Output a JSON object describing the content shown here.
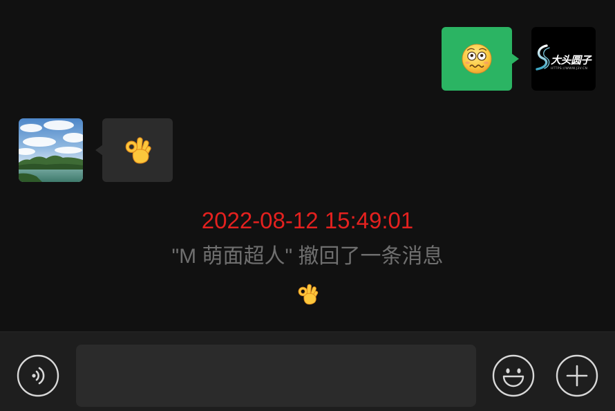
{
  "outgoing_message": {
    "bubble_color": "#2bb463",
    "sticker_icon": "nervous-face-icon",
    "avatar": {
      "icon": "brand-logo-avatar",
      "logo_text": "大头圆子",
      "logo_subtext": "HTTPS://WWW.J3V.CN"
    }
  },
  "incoming_message": {
    "bubble_color": "#2c2c2c",
    "sticker_icon": "ok-hand-icon",
    "avatar": {
      "icon": "landscape-photo-avatar"
    }
  },
  "recall_notice": {
    "timestamp": "2022-08-12 15:49:01",
    "timestamp_color": "#e3211f",
    "text": "\"M 萌面超人\" 撤回了一条消息",
    "text_color": "#6f6f6f",
    "sticker_icon": "ok-hand-icon"
  },
  "input_bar": {
    "voice_button_icon": "voice-icon",
    "message_input_value": "",
    "emoji_button_icon": "smiley-icon",
    "more_button_icon": "plus-icon"
  },
  "theme": {
    "background": "#111111",
    "input_bar_background": "#1e1e1e",
    "input_field_background": "#2b2b2b",
    "icon_color": "#d8d8d8"
  }
}
